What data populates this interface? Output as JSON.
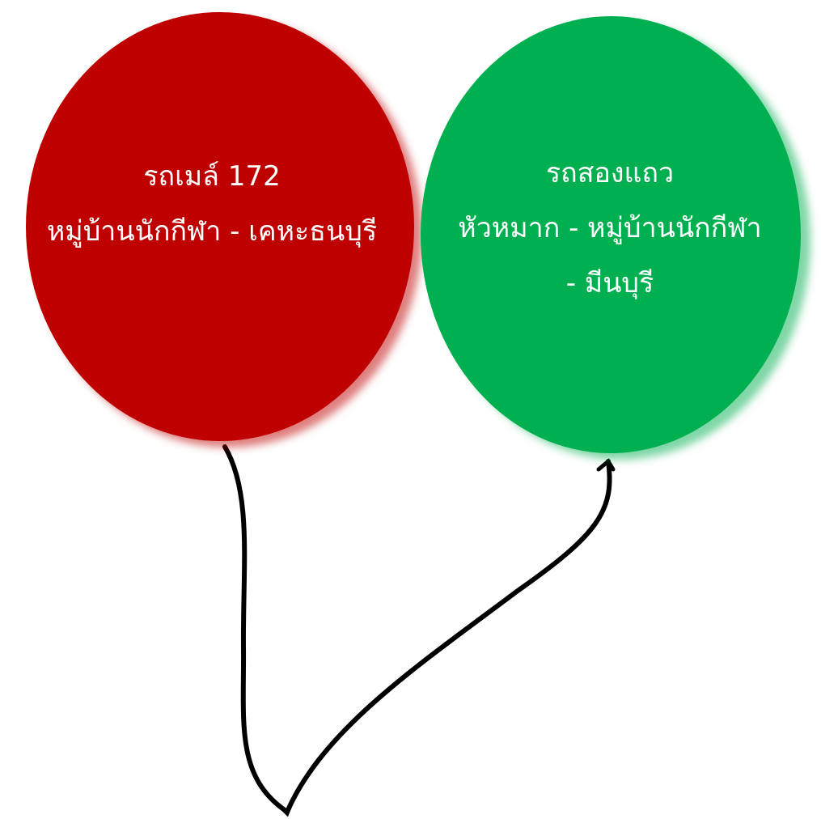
{
  "balloons": {
    "red": {
      "color": "#bf0000",
      "line1": "รถเมล์ 172",
      "line2": "หมู่บ้านนักกีฬา - เคหะธนบุรี"
    },
    "green": {
      "color": "#00b050",
      "line1": "รถสองแถว",
      "line2": "หัวหมาก - หมู่บ้านนักกีฬา",
      "line3": "- มีนบุรี"
    }
  },
  "string_color": "#000000"
}
